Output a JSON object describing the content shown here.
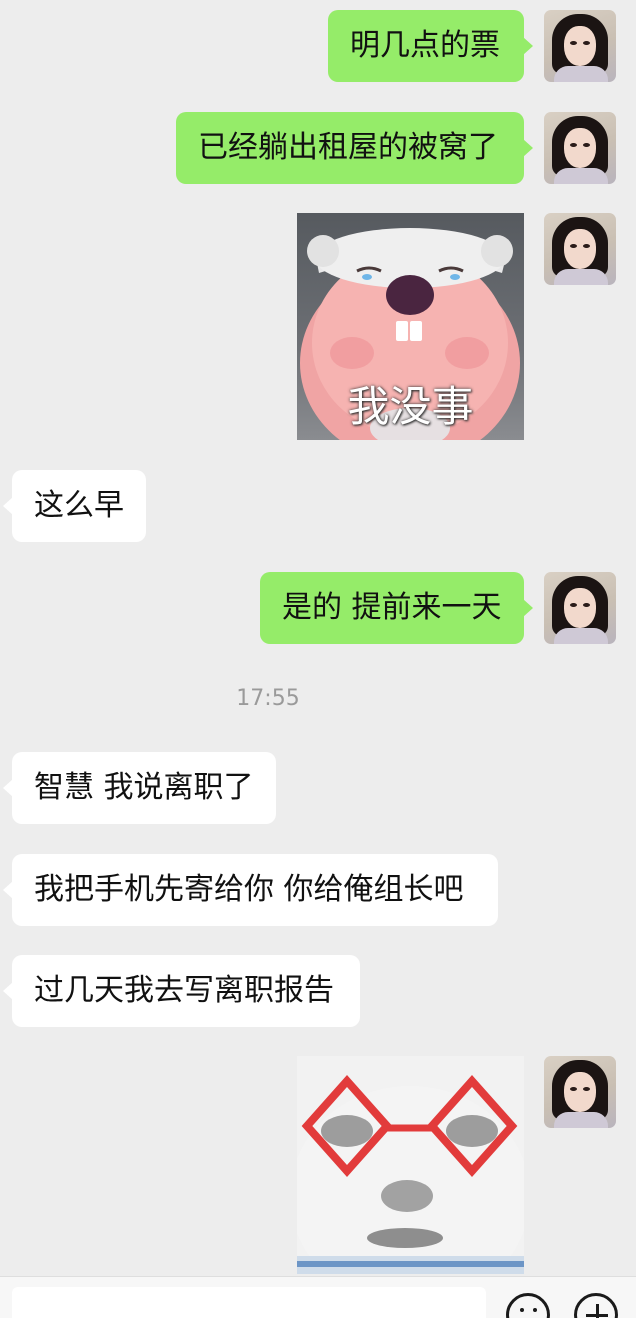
{
  "messages": [
    {
      "side": "out",
      "text": "明几点的票"
    },
    {
      "side": "out",
      "text": "已经躺出租屋的被窝了"
    },
    {
      "side": "out",
      "sticker": "pink-beaver-sticker",
      "sticker_text": "我没事"
    },
    {
      "side": "in",
      "text": "这么早"
    },
    {
      "side": "out",
      "text": "是的 提前来一天"
    },
    {
      "side": "in",
      "text": "智慧 我说离职了"
    },
    {
      "side": "in",
      "text": "我把手机先寄给你  你给俺组长吧"
    },
    {
      "side": "in",
      "text": "过几天我去写离职报告"
    },
    {
      "side": "out",
      "sticker": "panda-red-glasses-sticker"
    }
  ],
  "timestamp": "17:55",
  "colors": {
    "background": "#ededed",
    "outgoing_bubble": "#95ec69",
    "incoming_bubble": "#ffffff",
    "timestamp_text": "#9a9a9a"
  },
  "icons": {
    "emoji": "emoji-icon",
    "plus": "plus-icon"
  }
}
